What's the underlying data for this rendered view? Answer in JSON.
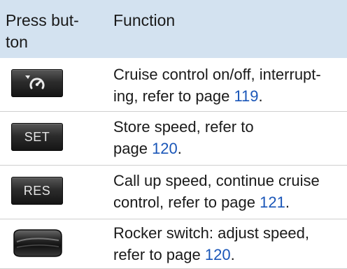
{
  "header": {
    "col1": "Press but-\nton",
    "col2": "Function"
  },
  "rows": [
    {
      "icon": "cruise-control-button-icon",
      "text_before": "Cruise control on/off, interrupt-\ning, refer to page ",
      "page": "119",
      "text_after": "."
    },
    {
      "icon": "set-button-icon",
      "button_label": "SET",
      "text_before": "Store speed, refer to\npage ",
      "page": "120",
      "text_after": "."
    },
    {
      "icon": "res-button-icon",
      "button_label": "RES",
      "text_before": "Call up speed, continue cruise\ncontrol, refer to page ",
      "page": "121",
      "text_after": "."
    },
    {
      "icon": "rocker-switch-icon",
      "text_before": "Rocker switch: adjust speed,\nrefer to page ",
      "page": "120",
      "text_after": "."
    }
  ],
  "colors": {
    "header_bg": "#d3e2f0",
    "link": "#1a56b8"
  }
}
